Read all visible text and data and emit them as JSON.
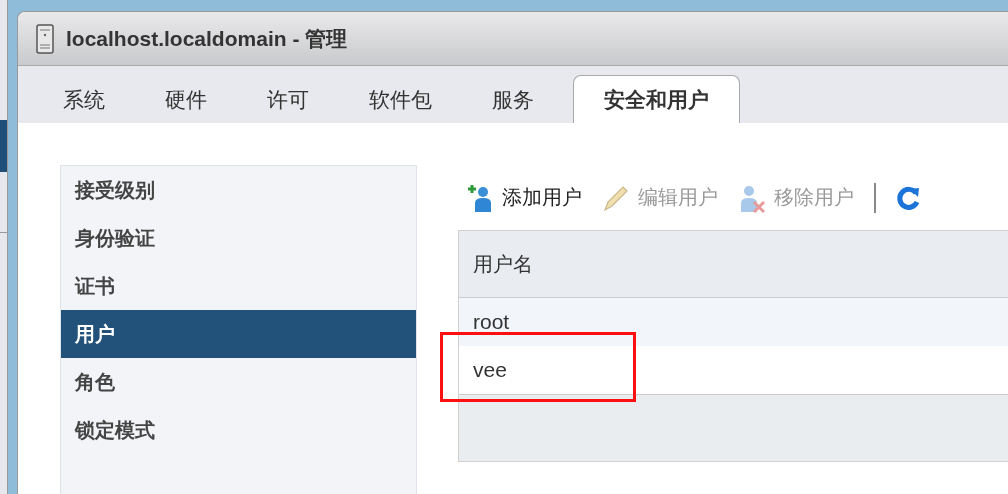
{
  "window": {
    "title": "localhost.localdomain - 管理"
  },
  "tabs": [
    {
      "label": "系统",
      "selected": false
    },
    {
      "label": "硬件",
      "selected": false
    },
    {
      "label": "许可",
      "selected": false
    },
    {
      "label": "软件包",
      "selected": false
    },
    {
      "label": "服务",
      "selected": false
    },
    {
      "label": "安全和用户",
      "selected": true
    }
  ],
  "sidebar": {
    "items": [
      {
        "label": "接受级别",
        "selected": false
      },
      {
        "label": "身份验证",
        "selected": false
      },
      {
        "label": "证书",
        "selected": false
      },
      {
        "label": "用户",
        "selected": true
      },
      {
        "label": "角色",
        "selected": false
      },
      {
        "label": "锁定模式",
        "selected": false
      }
    ]
  },
  "toolbar": [
    {
      "kind": "add",
      "label": "添加用户",
      "disabled": false
    },
    {
      "kind": "edit",
      "label": "编辑用户",
      "disabled": true
    },
    {
      "kind": "remove",
      "label": "移除用户",
      "disabled": true
    },
    {
      "kind": "refresh"
    }
  ],
  "table": {
    "columns": [
      "用户名"
    ],
    "rows": [
      {
        "cells": [
          "root"
        ],
        "highlighted": false
      },
      {
        "cells": [
          "vee"
        ],
        "highlighted": true
      }
    ]
  }
}
